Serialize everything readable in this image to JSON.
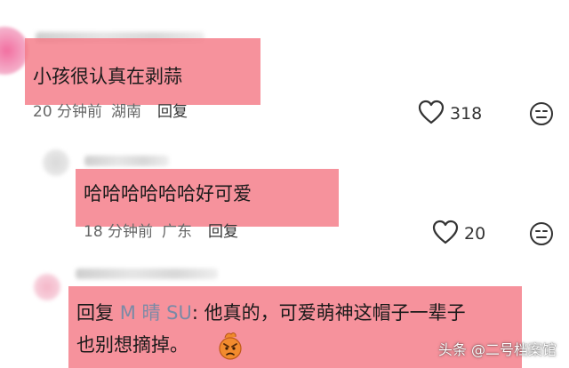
{
  "comments": [
    {
      "text": "小孩很认真在剥蒜",
      "time": "20 分钟前",
      "location": "湖南",
      "reply_label": "回复",
      "likes": "318"
    },
    {
      "text": "哈哈哈哈哈哈好可爱",
      "time": "18 分钟前",
      "location": "广东",
      "reply_label": "回复",
      "likes": "20"
    }
  ],
  "reply_comment": {
    "prefix": "回复",
    "username": "M 晴 SU",
    "line1_rest": ": 他真的，可爱萌神这帽子一辈子",
    "line2": "也别想摘掉。"
  },
  "watermark": {
    "text": "头条 @二号档案馆"
  },
  "colors": {
    "highlight": "#f47a86",
    "username_link": "#7a8aa6"
  },
  "icons": [
    "heart-outline-icon",
    "meh-face-icon",
    "angry-emoji-icon"
  ]
}
